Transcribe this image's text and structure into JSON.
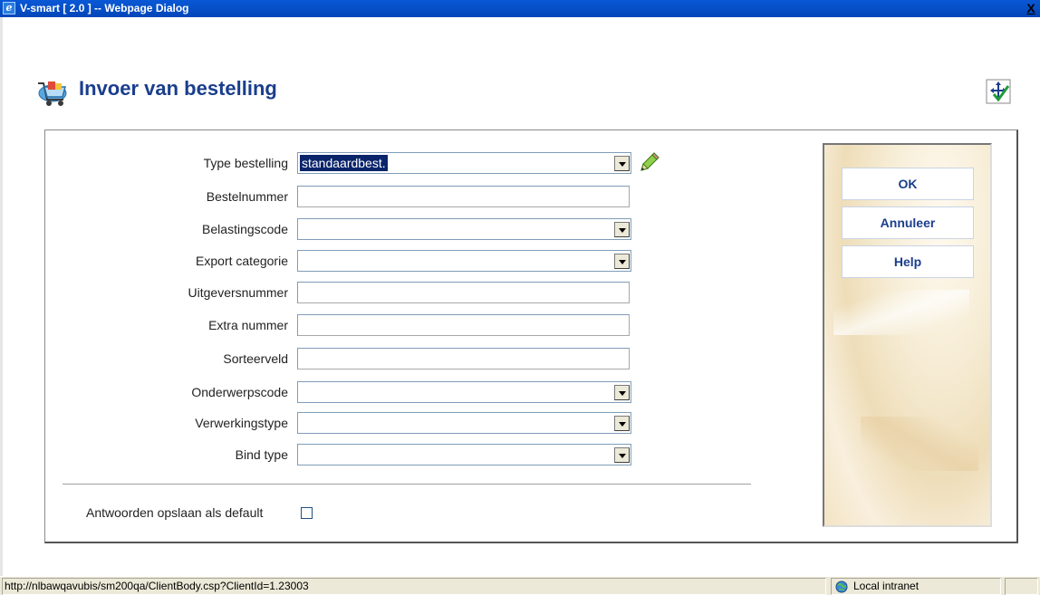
{
  "window": {
    "title": "V-smart [ 2.0 ] -- Webpage Dialog",
    "close_label": "X"
  },
  "page": {
    "title": "Invoer van bestelling",
    "header_icon": "shopping-cart-icon",
    "top_right_icon": "move-checkmark-icon"
  },
  "form": {
    "fields": [
      {
        "label": "Type bestelling",
        "kind": "select",
        "value": "standaardbest."
      },
      {
        "label": "Bestelnummer",
        "kind": "text",
        "value": ""
      },
      {
        "label": "Belastingscode",
        "kind": "select",
        "value": ""
      },
      {
        "label": "Export categorie",
        "kind": "select",
        "value": ""
      },
      {
        "label": "Uitgeversnummer",
        "kind": "text",
        "value": ""
      },
      {
        "label": "Extra nummer",
        "kind": "text",
        "value": ""
      },
      {
        "label": "Sorteerveld",
        "kind": "text",
        "value": ""
      },
      {
        "label": "Onderwerpscode",
        "kind": "select",
        "value": ""
      },
      {
        "label": "Verwerkingstype",
        "kind": "select",
        "value": ""
      },
      {
        "label": "Bind type",
        "kind": "select",
        "value": ""
      }
    ],
    "edit_icon": "pencil-icon",
    "save_default_label": "Antwoorden opslaan als default",
    "save_default_checked": false
  },
  "buttons": {
    "ok": "OK",
    "cancel": "Annuleer",
    "help": "Help"
  },
  "statusbar": {
    "url": "http://nlbawqavubis/sm200qa/ClientBody.csp?ClientId=1.23003",
    "zone": "Local intranet",
    "zone_icon": "globe-icon"
  }
}
